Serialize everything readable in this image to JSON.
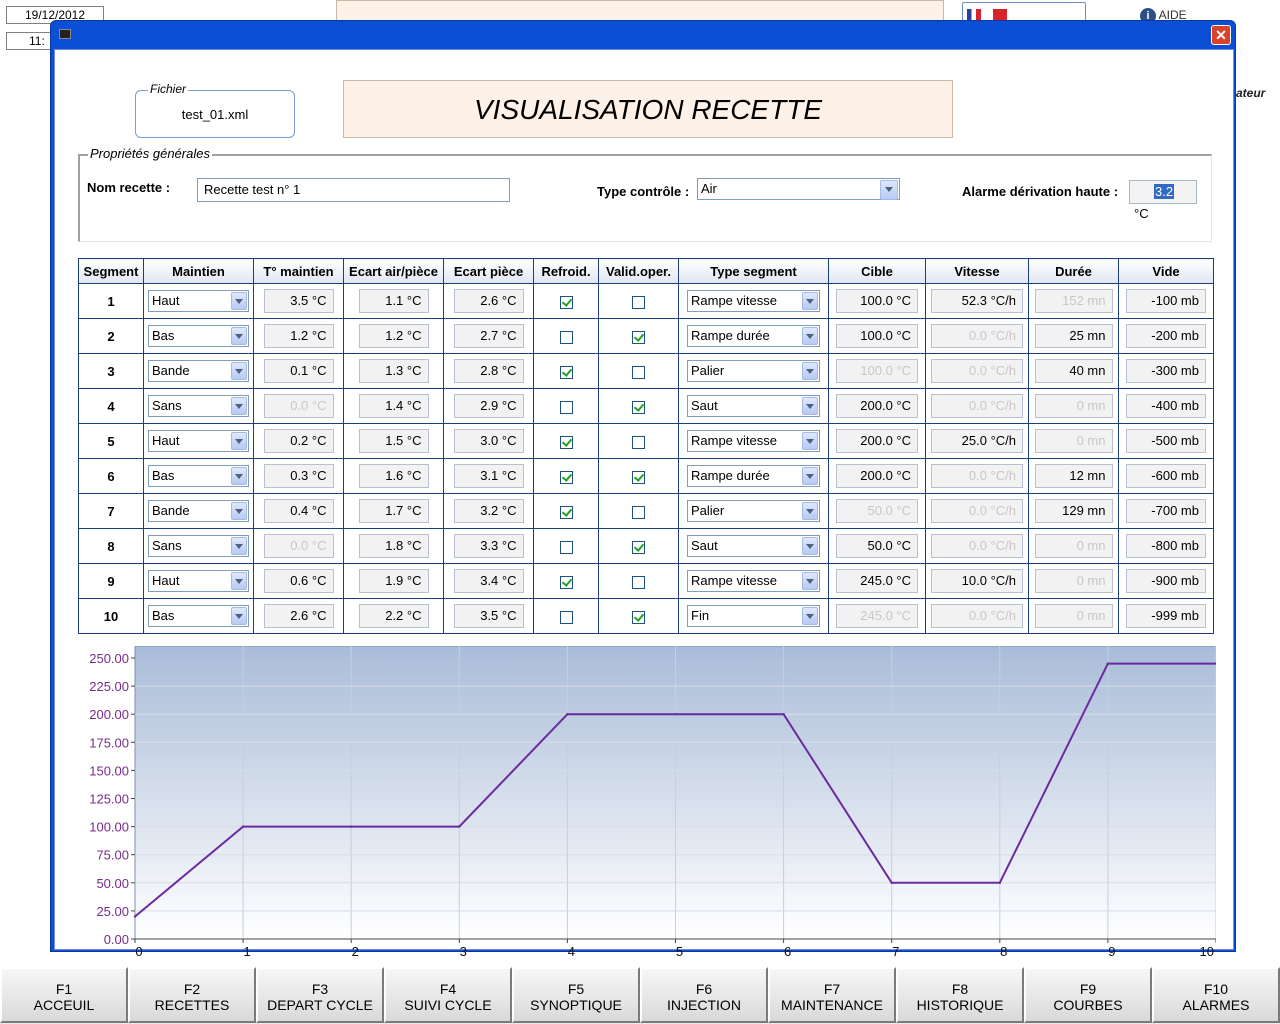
{
  "background": {
    "date": "19/12/2012",
    "time": "11:",
    "help_text": "AIDE",
    "side_label": "ateur"
  },
  "dialog": {
    "close_label": "✕",
    "file_legend": "Fichier",
    "file_name": "test_01.xml",
    "title": "VISUALISATION RECETTE",
    "props_legend": "Propriétés générales",
    "recipe_name_label": "Nom recette :",
    "recipe_name": "Recette test n° 1",
    "control_type_label": "Type contrôle :",
    "control_type": "Air",
    "alarm_label": "Alarme dérivation haute :",
    "alarm_value": "3.2",
    "alarm_unit": "°C"
  },
  "table": {
    "headers": [
      "Segment",
      "Maintien",
      "T° maintien",
      "Ecart air/pièce",
      "Ecart pièce",
      "Refroid.",
      "Valid.oper.",
      "Type segment",
      "Cible",
      "Vitesse",
      "Durée",
      "Vide"
    ],
    "rows": [
      {
        "seg": "1",
        "maintien": "Haut",
        "t_maintien": "3.5 °C",
        "t_dis": false,
        "ecart_air": "1.1 °C",
        "ecart_piece": "2.6 °C",
        "refroid": true,
        "valid": false,
        "type": "Rampe vitesse",
        "cible": "100.0 °C",
        "cible_dis": false,
        "vitesse": "52.3 °C/h",
        "vitesse_dis": false,
        "duree": "152 mn",
        "duree_dis": true,
        "vide": "-100 mb"
      },
      {
        "seg": "2",
        "maintien": "Bas",
        "t_maintien": "1.2 °C",
        "t_dis": false,
        "ecart_air": "1.2 °C",
        "ecart_piece": "2.7 °C",
        "refroid": false,
        "valid": true,
        "type": "Rampe durée",
        "cible": "100.0 °C",
        "cible_dis": false,
        "vitesse": "0.0 °C/h",
        "vitesse_dis": true,
        "duree": "25 mn",
        "duree_dis": false,
        "vide": "-200 mb"
      },
      {
        "seg": "3",
        "maintien": "Bande",
        "t_maintien": "0.1 °C",
        "t_dis": false,
        "ecart_air": "1.3 °C",
        "ecart_piece": "2.8 °C",
        "refroid": true,
        "valid": false,
        "type": "Palier",
        "cible": "100.0 °C",
        "cible_dis": true,
        "vitesse": "0.0 °C/h",
        "vitesse_dis": true,
        "duree": "40 mn",
        "duree_dis": false,
        "vide": "-300 mb"
      },
      {
        "seg": "4",
        "maintien": "Sans",
        "t_maintien": "0.0 °C",
        "t_dis": true,
        "ecart_air": "1.4 °C",
        "ecart_piece": "2.9 °C",
        "refroid": false,
        "valid": true,
        "type": "Saut",
        "cible": "200.0 °C",
        "cible_dis": false,
        "vitesse": "0.0 °C/h",
        "vitesse_dis": true,
        "duree": "0 mn",
        "duree_dis": true,
        "vide": "-400 mb"
      },
      {
        "seg": "5",
        "maintien": "Haut",
        "t_maintien": "0.2 °C",
        "t_dis": false,
        "ecart_air": "1.5 °C",
        "ecart_piece": "3.0 °C",
        "refroid": true,
        "valid": false,
        "type": "Rampe vitesse",
        "cible": "200.0 °C",
        "cible_dis": false,
        "vitesse": "25.0 °C/h",
        "vitesse_dis": false,
        "duree": "0 mn",
        "duree_dis": true,
        "vide": "-500 mb"
      },
      {
        "seg": "6",
        "maintien": "Bas",
        "t_maintien": "0.3 °C",
        "t_dis": false,
        "ecart_air": "1.6 °C",
        "ecart_piece": "3.1 °C",
        "refroid": true,
        "valid": true,
        "type": "Rampe durée",
        "cible": "200.0 °C",
        "cible_dis": false,
        "vitesse": "0.0 °C/h",
        "vitesse_dis": true,
        "duree": "12 mn",
        "duree_dis": false,
        "vide": "-600 mb"
      },
      {
        "seg": "7",
        "maintien": "Bande",
        "t_maintien": "0.4 °C",
        "t_dis": false,
        "ecart_air": "1.7 °C",
        "ecart_piece": "3.2 °C",
        "refroid": true,
        "valid": false,
        "type": "Palier",
        "cible": "50.0 °C",
        "cible_dis": true,
        "vitesse": "0.0 °C/h",
        "vitesse_dis": true,
        "duree": "129 mn",
        "duree_dis": false,
        "vide": "-700 mb"
      },
      {
        "seg": "8",
        "maintien": "Sans",
        "t_maintien": "0.0 °C",
        "t_dis": true,
        "ecart_air": "1.8 °C",
        "ecart_piece": "3.3 °C",
        "refroid": false,
        "valid": true,
        "type": "Saut",
        "cible": "50.0 °C",
        "cible_dis": false,
        "vitesse": "0.0 °C/h",
        "vitesse_dis": true,
        "duree": "0 mn",
        "duree_dis": true,
        "vide": "-800 mb"
      },
      {
        "seg": "9",
        "maintien": "Haut",
        "t_maintien": "0.6 °C",
        "t_dis": false,
        "ecart_air": "1.9 °C",
        "ecart_piece": "3.4 °C",
        "refroid": true,
        "valid": false,
        "type": "Rampe vitesse",
        "cible": "245.0 °C",
        "cible_dis": false,
        "vitesse": "10.0 °C/h",
        "vitesse_dis": false,
        "duree": "0 mn",
        "duree_dis": true,
        "vide": "-900 mb"
      },
      {
        "seg": "10",
        "maintien": "Bas",
        "t_maintien": "2.6 °C",
        "t_dis": false,
        "ecart_air": "2.2 °C",
        "ecart_piece": "3.5 °C",
        "refroid": false,
        "valid": true,
        "type": "Fin",
        "cible": "245.0 °C",
        "cible_dis": true,
        "vitesse": "0.0 °C/h",
        "vitesse_dis": true,
        "duree": "0 mn",
        "duree_dis": true,
        "vide": "-999 mb"
      }
    ]
  },
  "chart_data": {
    "type": "line",
    "x": [
      0,
      1,
      2,
      3,
      4,
      5,
      6,
      7,
      8,
      9,
      10
    ],
    "y": [
      20,
      100,
      100,
      100,
      200,
      200,
      200,
      50,
      50,
      245,
      245
    ],
    "xticks": [
      "0",
      "1",
      "2",
      "3",
      "4",
      "5",
      "6",
      "7",
      "8",
      "9",
      "10"
    ],
    "yticks": [
      "250.00",
      "225.00",
      "200.00",
      "175.00",
      "150.00",
      "125.00",
      "100.00",
      "75.00",
      "50.00",
      "25.00",
      "0.00"
    ],
    "xlim": [
      0,
      10
    ],
    "ylim": [
      0,
      250
    ],
    "grid": true,
    "line_color": "#6b2aa0",
    "tick_color": "#7a2a8f"
  },
  "fkeys": [
    {
      "key": "F1",
      "label": "ACCEUIL"
    },
    {
      "key": "F2",
      "label": "RECETTES"
    },
    {
      "key": "F3",
      "label": "DEPART CYCLE"
    },
    {
      "key": "F4",
      "label": "SUIVI CYCLE"
    },
    {
      "key": "F5",
      "label": "SYNOPTIQUE"
    },
    {
      "key": "F6",
      "label": "INJECTION"
    },
    {
      "key": "F7",
      "label": "MAINTENANCE"
    },
    {
      "key": "F8",
      "label": "HISTORIQUE"
    },
    {
      "key": "F9",
      "label": "COURBES"
    },
    {
      "key": "F10",
      "label": "ALARMES"
    }
  ]
}
